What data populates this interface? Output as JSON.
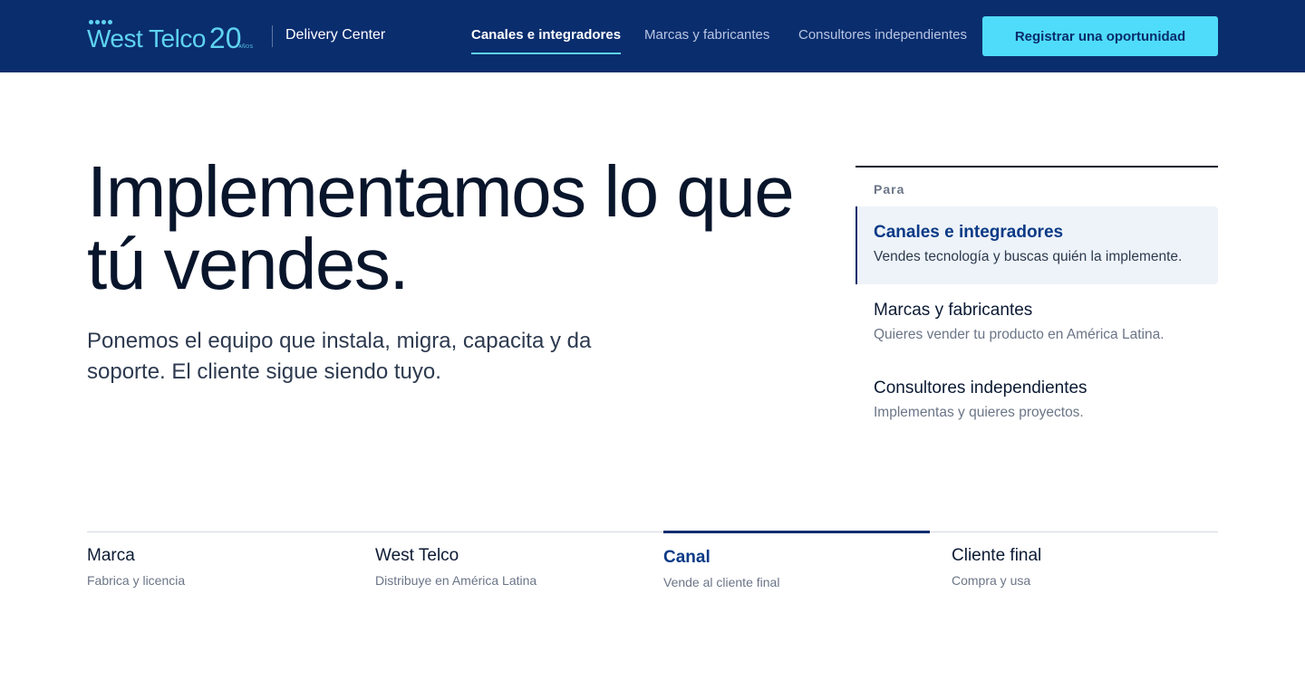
{
  "header": {
    "logo_text": "West Telco",
    "logo_number": "20",
    "logo_suffix": "AÑOS",
    "section_title": "Delivery Center",
    "nav": [
      {
        "label": "Canales e integradores",
        "active": true
      },
      {
        "label": "Marcas y fabricantes",
        "active": false
      },
      {
        "label": "Consultores independientes",
        "active": false
      }
    ],
    "cta_label": "Registrar una oportunidad"
  },
  "hero": {
    "title_line1": "Implementamos lo que",
    "title_line2": "tú vendes.",
    "subtitle_line1": "Ponemos el equipo que instala, migra, capacita y da",
    "subtitle_line2": "soporte. El cliente sigue siendo tuyo."
  },
  "audience": {
    "label": "Para",
    "items": [
      {
        "title": "Canales e integradores",
        "description": "Vendes tecnología y buscas quién la implemente.",
        "active": true
      },
      {
        "title": "Marcas y fabricantes",
        "description": "Quieres vender tu producto en América Latina.",
        "active": false
      },
      {
        "title": "Consultores independientes",
        "description": "Implementas y quieres proyectos.",
        "active": false
      }
    ]
  },
  "chain": [
    {
      "title": "Marca",
      "description": "Fabrica y licencia",
      "active": false
    },
    {
      "title": "West Telco",
      "description": "Distribuye en América Latina",
      "active": false
    },
    {
      "title": "Canal",
      "description": "Vende al cliente final",
      "active": true
    },
    {
      "title": "Cliente final",
      "description": "Compra y usa",
      "active": false
    }
  ],
  "colors": {
    "header_bg": "#0a2d6e",
    "accent_cyan": "#4fdcfa",
    "brand_blue": "#0a3a86"
  }
}
